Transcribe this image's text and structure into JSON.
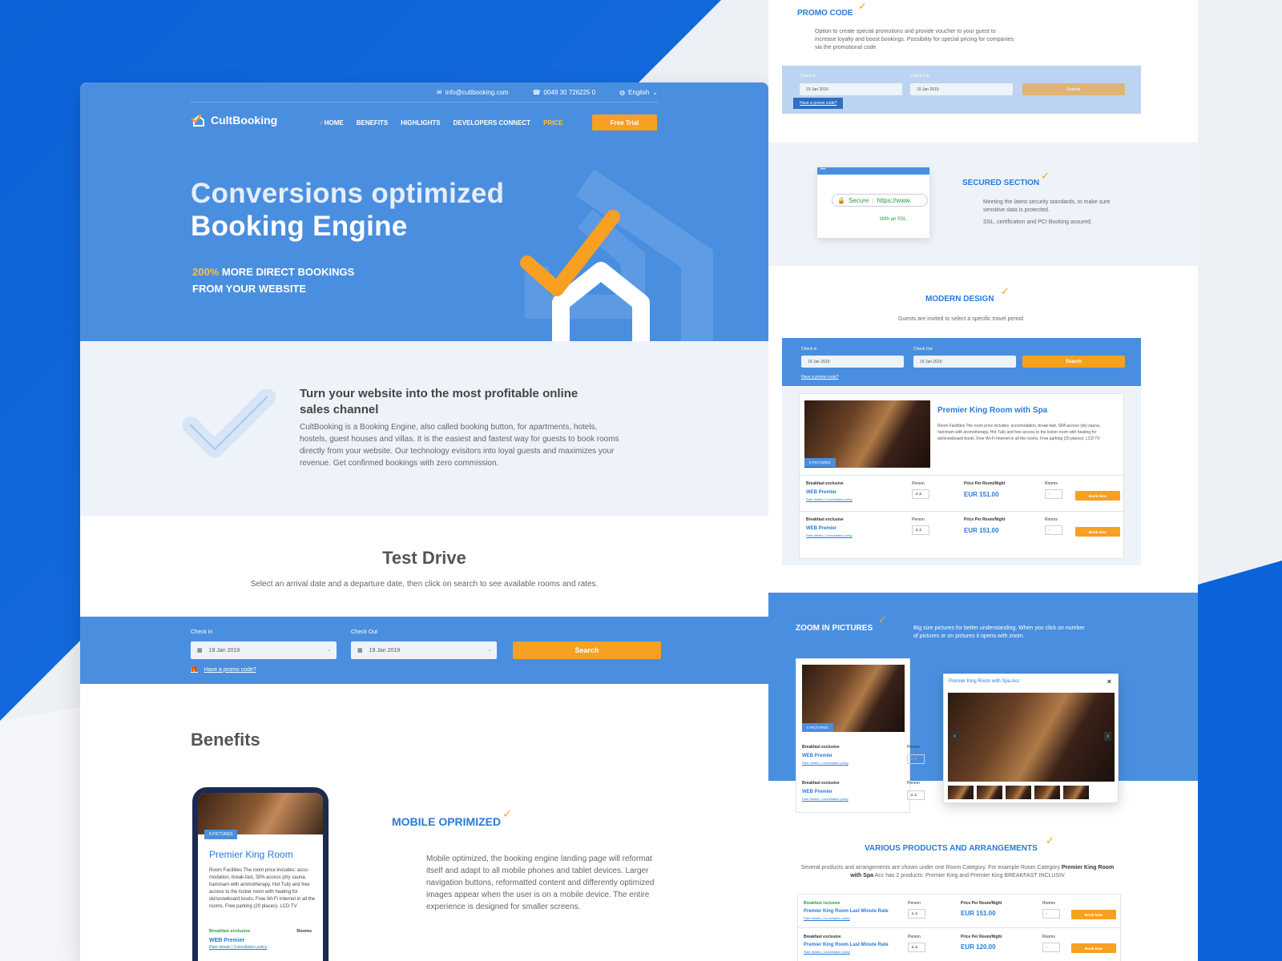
{
  "colors": {
    "accent": "#f7a021",
    "brand": "#4a8fdf",
    "link": "#2a7ad6"
  },
  "topbar": {
    "email": "info@cultbooking.com",
    "phone": "0049 30 726225 0",
    "language": "English"
  },
  "logo": "CultBooking",
  "nav": {
    "home": "HOME",
    "benefits": "BENEFITS",
    "highlights": "HIGHLIGHTS",
    "developers": "DEVELOPERS CONNECT",
    "price": "PRICE",
    "trial": "Free Trial"
  },
  "hero": {
    "line1": "Conversions optimized",
    "line2": "Booking Engine",
    "pct": "200%",
    "sub1": " MORE DIRECT BOOKINGS",
    "sub2": "FROM YOUR WEBSITE"
  },
  "intro": {
    "title": "Turn your website into the most profitable online sales channel",
    "body": "CultBooking is a Booking Engine, also called booking button, for apartments, hotels, hostels, guest houses and villas. It is the easiest and fastest way for guests to book rooms directly from your website. Our technology evisitors into loyal guests and maximizes your revenue. Get confirmed bookings with zero commission."
  },
  "test": {
    "title": "Test Drive",
    "desc": "Select an arrival date and a departure date, then click on search to see available rooms and rates."
  },
  "search": {
    "checkin_label": "Check in",
    "checkout_label": "Check Out",
    "checkin": "19 Jan 2019",
    "checkout": "19 Jan 2019",
    "button": "Search",
    "promo": "Have a promo code?"
  },
  "benefits": {
    "title": "Benefits",
    "mobile_title": "MOBILE OPRIMIZED",
    "mobile_body": "Mobile optimized, the booking engine landing page will reformat itself and adapt to all mobile phones and tablet devices. Larger navigation buttons, reformatted content and differently optimized images appear when the user is on a mobile device. The entire experience is designed for smaller screens."
  },
  "phone": {
    "pics": "5 PICTURES",
    "room": "Premier King Room",
    "desc": "Room Facilities The room price includes: acco- modation, break-fast, SPA access (dry sauna, hammam with aromotherapy, Hot Tub) and free access to the locker room with heating for ski/snowboard boots. Free Wi-Fi Internet in all the rooms. Free parking (20 places). LCD TV",
    "breakfast": "Breakfast exclusive",
    "rooms": "Rooms",
    "web": "WEB Premier",
    "rate": "Rate details | Cancellation policy"
  },
  "promo": {
    "title": "PROMO CODE",
    "desc": "Option to create special promotions and provide voucher to your guest to increase loyalty and boost bookings. Possibility for special pricing for companies via the promotional code"
  },
  "secured": {
    "title": "SECURED SECTION",
    "desc1": "Meeting the latest security standards, to make sure sensitive data is protected.",
    "desc2": "SSL, certification and PCI Booking assured.",
    "secure": "Secure",
    "url": "https://www.",
    "ssl": "With an SSL"
  },
  "modern": {
    "title": "MODERN DESIGN",
    "desc": "Guests are invited to select a specific travel period",
    "room": "Premier King Room with Spa",
    "facilities": "Room Facilities The room price includes: accomodation, break-fast, SPA access (dry sauna, hammam with aromotherapy, Hot Tub) and free access to the locker room with heating for ski/snowboard boots. Free Wi-Fi Internet in all the rooms. Free parking (20 places). LCD TV",
    "pics": "5 PICTURES",
    "rows": [
      {
        "breakfast": "Breakfast exclusive",
        "web": "WEB Premier",
        "rate": "Rate details | Cancellation policy",
        "person": "Person",
        "price_label": "Price Per Room/Night",
        "price": "EUR 151.00",
        "rooms": "Rooms",
        "book": "Book Now"
      },
      {
        "breakfast": "Breakfast exclusive",
        "web": "WEB Premier",
        "rate": "Rate details | Cancellation policy",
        "person": "Person",
        "price_label": "Price Per Room/Night",
        "price": "EUR 151.00",
        "rooms": "Rooms",
        "book": "Book Now"
      }
    ]
  },
  "zoom": {
    "title": "ZOOM IN PICTURES",
    "desc": "Big size pictures for better understanding. When you click on number of pictures or on pictures it opens with zoom.",
    "pics": "5 PICTURES",
    "popup": "Premier King Room with Spa Acc",
    "close": "×",
    "b1": "Breakfast exclusive",
    "w1": "WEB Premier",
    "r1": "Rate details | Cancellation policy",
    "p1": "Person",
    "b2": "Breakfast exclusive",
    "w2": "WEB Premier",
    "r2": "Rate details | Cancellation policy",
    "p2": "Person"
  },
  "various": {
    "title": "VARIOUS PRODUCTS AND ARRANGEMENTS",
    "desc_a": "Several products and arrangements are shown under one Room Category. For example Room Category ",
    "desc_b": "Premier King Room with Spa",
    "desc_c": " Acc has 2 products: Premier King and Premier King BREAKFAST INCLUSIV",
    "rows": [
      {
        "breakfast": "Breakfast inclusive",
        "name": "Premier King Room Last Minute Rate",
        "rate": "Rate details | Cancellation policy",
        "person": "Person",
        "price_label": "Price Per Room/Night",
        "price": "EUR 151.00",
        "rooms": "Rooms",
        "book": "Book Now"
      },
      {
        "breakfast": "Breakfast exclusive",
        "name": "Premier King Room Last Minute Rate",
        "rate": "Rate details | Cancellation policy",
        "person": "Person",
        "price_label": "Price Per Room/Night",
        "price": "EUR 120.00",
        "rooms": "Rooms",
        "book": "Book Now"
      }
    ]
  }
}
